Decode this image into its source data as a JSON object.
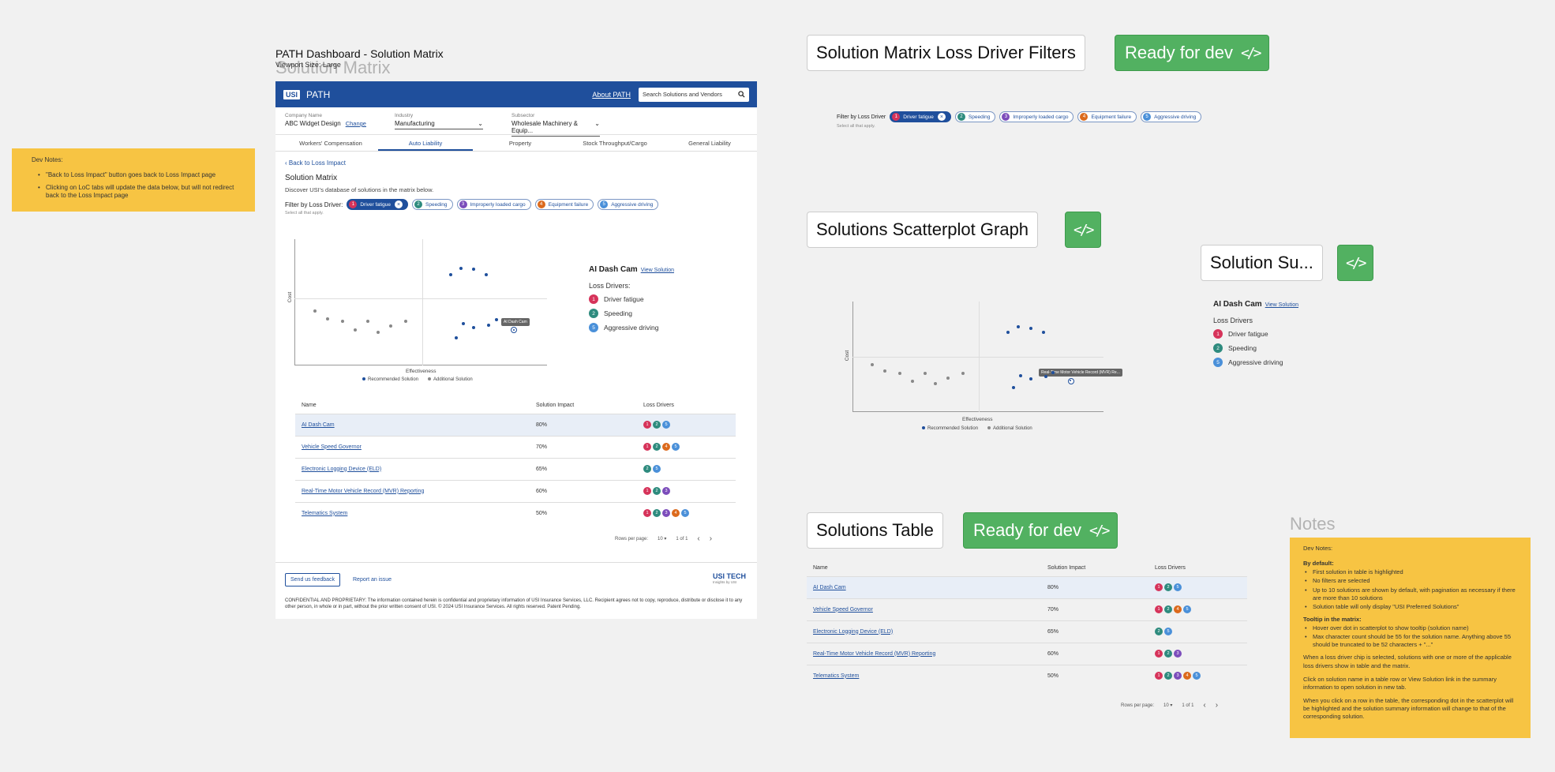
{
  "frame": {
    "title": "PATH Dashboard - Solution Matrix",
    "viewport": "Viewport Size: Large",
    "ghost": "Solution Matrix"
  },
  "dev_notes_left": {
    "title": "Dev Notes:",
    "items": [
      "\"Back to Loss Impact\" button goes back to Loss Impact page",
      "Clicking on LoC tabs will update the data below, but will not redirect back to the Loss Impact page"
    ]
  },
  "app": {
    "logo": "USI",
    "brand": "PATH",
    "about": "About PATH",
    "search_placeholder": "Search Solutions and Vendors",
    "company_label": "Company Name",
    "company_value": "ABC Widget Design",
    "change": "Change",
    "industry_label": "Industry",
    "industry_value": "Manufacturing",
    "subsector_label": "Subsector",
    "subsector_value": "Wholesale Machinery & Equip...",
    "tabs": [
      "Workers' Compensation",
      "Auto Liability",
      "Property",
      "Stock Throughput/Cargo",
      "General Liability"
    ],
    "back": "Back to Loss Impact",
    "section_title": "Solution Matrix",
    "description": "Discover USI's database of solutions in the matrix below.",
    "filter_label": "Filter by Loss Driver:",
    "filter_hint": "Select all that apply."
  },
  "loss_drivers": [
    {
      "n": "1",
      "label": "Driver fatigue",
      "color": "#d6335a",
      "selected": true
    },
    {
      "n": "2",
      "label": "Speeding",
      "color": "#2e8b7e",
      "selected": false
    },
    {
      "n": "3",
      "label": "Improperly loaded cargo",
      "color": "#7c4dbb",
      "selected": false
    },
    {
      "n": "4",
      "label": "Equipment failure",
      "color": "#dc6a1c",
      "selected": false
    },
    {
      "n": "5",
      "label": "Aggressive driving",
      "color": "#4a90d9",
      "selected": false
    }
  ],
  "chart_data": {
    "type": "scatter",
    "xlabel": "Effectiveness",
    "ylabel": "Cost",
    "series": [
      {
        "name": "Recommended Solution",
        "color": "#1f4f9c",
        "points": [
          [
            0.62,
            0.28
          ],
          [
            0.66,
            0.23
          ],
          [
            0.71,
            0.24
          ],
          [
            0.76,
            0.28
          ],
          [
            0.64,
            0.78
          ],
          [
            0.67,
            0.67
          ],
          [
            0.71,
            0.7
          ],
          [
            0.77,
            0.68
          ],
          [
            0.8,
            0.64
          ],
          [
            0.87,
            0.72
          ]
        ]
      },
      {
        "name": "Additional Solution",
        "color": "#888888",
        "points": [
          [
            0.08,
            0.57
          ],
          [
            0.13,
            0.63
          ],
          [
            0.19,
            0.65
          ],
          [
            0.24,
            0.72
          ],
          [
            0.29,
            0.65
          ],
          [
            0.33,
            0.74
          ],
          [
            0.38,
            0.69
          ],
          [
            0.44,
            0.65
          ]
        ]
      }
    ],
    "tooltip": "AI Dash Cam",
    "tooltip2": "Real-Time Motor Vehicle Record (MVR) Re...",
    "grid": false
  },
  "summary": {
    "title": "AI Dash Cam",
    "view": "View Solution",
    "drivers_label": "Loss Drivers:",
    "drivers_label2": "Loss Drivers",
    "drivers": [
      {
        "n": "1",
        "label": "Driver fatigue",
        "color": "#d6335a"
      },
      {
        "n": "2",
        "label": "Speeding",
        "color": "#2e8b7e"
      },
      {
        "n": "5",
        "label": "Aggressive driving",
        "color": "#4a90d9"
      }
    ]
  },
  "table": {
    "headers": [
      "Name",
      "Solution Impact",
      "Loss Drivers"
    ],
    "rows": [
      {
        "name": "AI Dash Cam",
        "impact": "80%",
        "drivers": [
          "1",
          "2",
          "5"
        ]
      },
      {
        "name": "Vehicle Speed Governor",
        "impact": "70%",
        "drivers": [
          "1",
          "2",
          "4",
          "5"
        ]
      },
      {
        "name": "Electronic Logging Device (ELD)",
        "impact": "65%",
        "drivers": [
          "2",
          "5"
        ]
      },
      {
        "name": "Real-Time Motor Vehicle Record (MVR) Reporting",
        "impact": "60%",
        "drivers": [
          "1",
          "2",
          "3"
        ]
      },
      {
        "name": "Telematics System",
        "impact": "50%",
        "drivers": [
          "1",
          "2",
          "3",
          "4",
          "5"
        ]
      }
    ],
    "rows_per_page_label": "Rows per page:",
    "rows_per_page": "10",
    "page": "1 of 1"
  },
  "footer": {
    "feedback": "Send us feedback",
    "report": "Report an issue",
    "logo": "USI TECH",
    "logo_sub": "Insights by USI",
    "confidential": "CONFIDENTIAL AND PROPRIETARY: The information contained herein is confidential and proprietary information of USI Insurance Services, LLC. Recipient agrees not to copy, reproduce, distribute or disclose it to any other person, in whole or in part, without the prior written consent of USI.   © 2024 USI Insurance Services. All rights reserved. Patent Pending."
  },
  "components": {
    "filters_title": "Solution Matrix Loss Driver Filters",
    "scatter_title": "Solutions Scatterplot Graph",
    "summary_title": "Solution Su...",
    "table_title": "Solutions Table",
    "ready": "Ready for dev",
    "filter_label": "Filter by Loss Driver",
    "notes_title": "Notes"
  },
  "dev_notes_right": {
    "title": "Dev Notes:",
    "default_title": "By default:",
    "default_items": [
      "First solution in table is highlighted",
      "No filters are selected",
      "Up to 10 solutions are shown by default, with pagination as necessary if there are more than 10 solutions",
      "Solution table will only display \"USI Preferred Solutions\""
    ],
    "tooltip_title": "Tooltip in the matrix:",
    "tooltip_items": [
      "Hover over dot in scatterplot to show tooltip (solution name)",
      "Max character count should be 55 for the solution name. Anything above 55 should be truncated to be 52 characters + \"...\""
    ],
    "p1": "When a loss driver chip is selected, solutions with one or more of the applicable loss drivers show in table and the matrix.",
    "p2": "Click on solution name in a table row or View Solution link in the summary information to open solution in new tab.",
    "p3": "When you click on a row in the table, the corresponding dot in the scatterplot will be highlighted and the solution summary information will change to that of the corresponding solution."
  }
}
